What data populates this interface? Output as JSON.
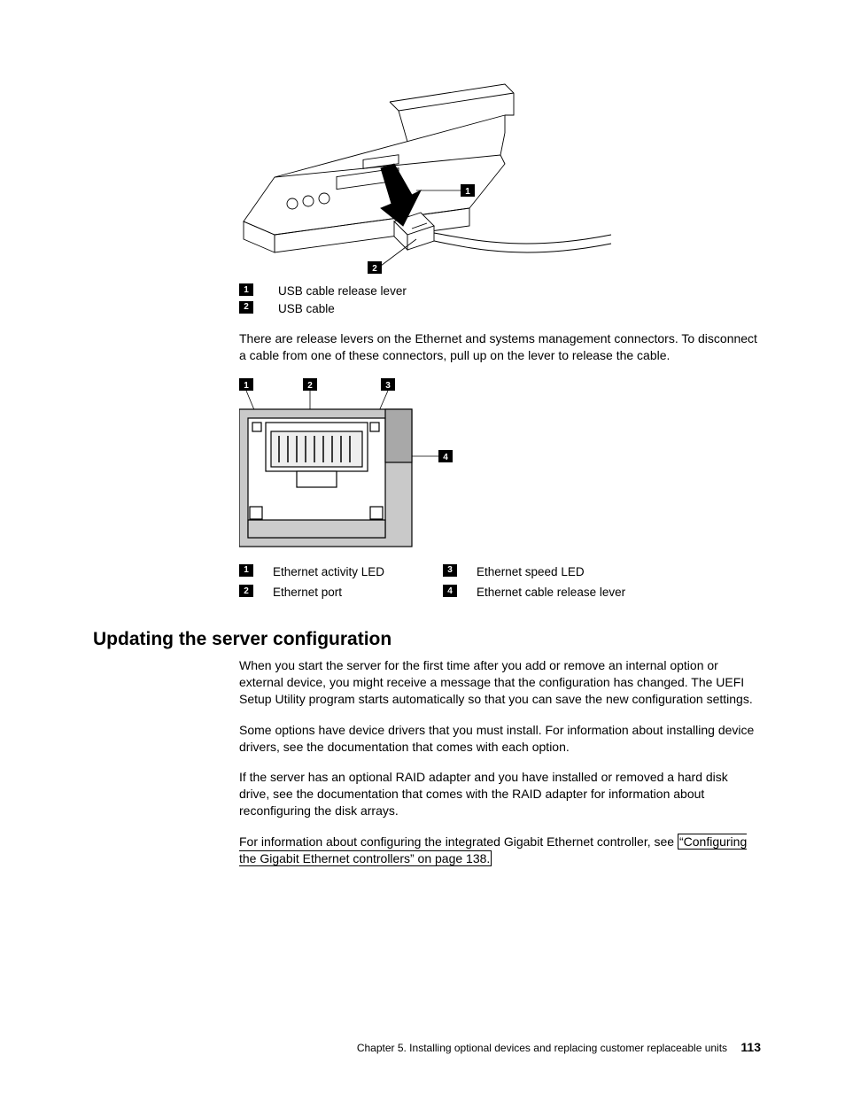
{
  "figure1": {
    "callout1": "1",
    "callout2": "2",
    "legend1": "USB cable release lever",
    "legend2": "USB cable"
  },
  "para1": "There are release levers on the Ethernet and systems management connectors. To disconnect a cable from one of these connectors, pull up on the lever to release the cable.",
  "figure2": {
    "callout1": "1",
    "callout2": "2",
    "callout3": "3",
    "callout4": "4",
    "legend1": "Ethernet activity LED",
    "legend2": "Ethernet port",
    "legend3": "Ethernet speed LED",
    "legend4": "Ethernet cable release lever"
  },
  "heading": "Updating the server configuration",
  "para2": "When you start the server for the first time after you add or remove an internal option or external device, you might receive a message that the configuration has changed. The UEFI Setup Utility program starts automatically so that you can save the new configuration settings.",
  "para3": "Some options have device drivers that you must install. For information about installing device drivers, see the documentation that comes with each option.",
  "para4": "If the server has an optional RAID adapter and you have installed or removed a hard disk drive, see the documentation that comes with the RAID adapter for information about reconfiguring the disk arrays.",
  "para5_pre": "For information about configuring the integrated Gigabit Ethernet controller, see ",
  "para5_link": "“Configuring the Gigabit Ethernet controllers” on page 138.",
  "footer": {
    "chapter": "Chapter 5. Installing optional devices and replacing customer replaceable units",
    "page": "113"
  }
}
